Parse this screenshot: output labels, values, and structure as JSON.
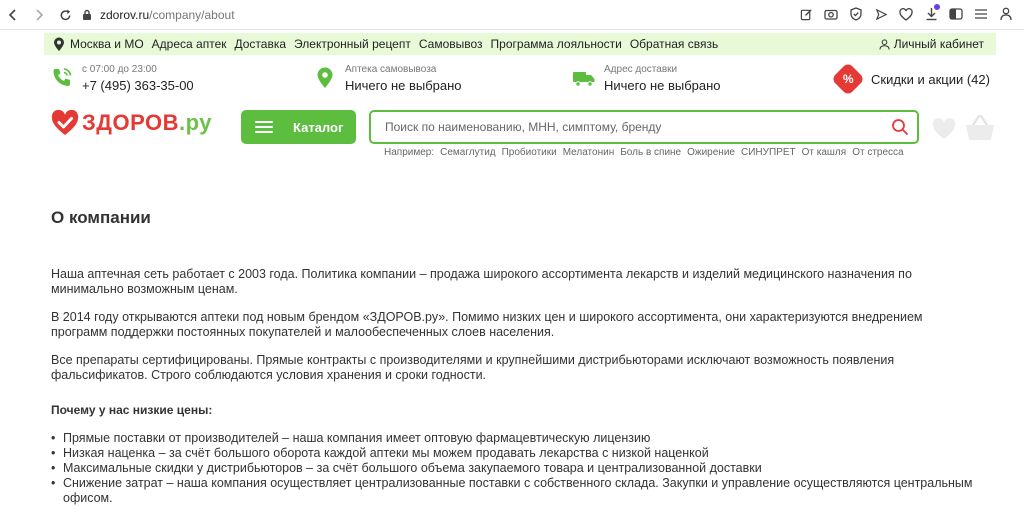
{
  "browser": {
    "url_domain": "zdorov.ru",
    "url_path": "/company/about"
  },
  "topstrip": {
    "links": [
      "Москва и МО",
      "Адреса аптек",
      "Доставка",
      "Электронный рецепт",
      "Самовывоз",
      "Программа лояльности",
      "Обратная связь"
    ],
    "cabinet": "Личный кабинет"
  },
  "info": {
    "phone_hours": "с 07:00 до 23:00",
    "phone": "+7 (495) 363-35-00",
    "pickup_label": "Аптека самовывоза",
    "pickup_value": "Ничего не выбрано",
    "delivery_label": "Адрес доставки",
    "delivery_value": "Ничего не выбрано",
    "discounts": "Скидки и акции (42)",
    "discount_badge": "%"
  },
  "header": {
    "logo_main": "ЗДОРОВ",
    "logo_suffix": ".ру",
    "catalog": "Каталог",
    "search_placeholder": "Поиск по наименованию, МНН, симптому, бренду",
    "hints_label": "Например:",
    "hints": [
      "Семаглутид",
      "Пробиотики",
      "Мелатонин",
      "Боль в спине",
      "Ожирение",
      "СИНУПРЕТ",
      "От кашля",
      "От стресса"
    ]
  },
  "content": {
    "title": "О компании",
    "p1": "Наша аптечная сеть работает с 2003 года. Политика компании – продажа широкого ассортимента лекарств и изделий медицинского назначения по минимально возможным ценам.",
    "p2": "В 2014 году открываются аптеки под новым брендом «ЗДОРОВ.ру». Помимо низких цен и широкого ассортимента, они характеризуются внедрением программ поддержки постоянных покупателей и малообеспеченных слоев населения.",
    "p3": "Все препараты сертифицированы. Прямые контракты с производителями и крупнейшими дистрибьюторами исключают возможность появления фальсификатов. Строго соблюдаются условия хранения и сроки годности.",
    "subheading": "Почему у нас низкие цены:",
    "bullets": [
      "Прямые поставки от производителей – наша компания имеет оптовую фармацевтическую лицензию",
      "Низкая наценка – за счёт большого оборота каждой аптеки мы можем продавать лекарства с низкой наценкой",
      "Максимальные скидки у дистрибьюторов – за счёт большого объема закупаемого товара и централизованной доставки",
      "Снижение затрат – наша компания осуществляет централизованные поставки с собственного склада. Закупки и управление осуществляются центральным офисом."
    ]
  },
  "colors": {
    "brand_green": "#5cbd3e",
    "strip_green": "#e8f9d8",
    "brand_red": "#e53935"
  }
}
